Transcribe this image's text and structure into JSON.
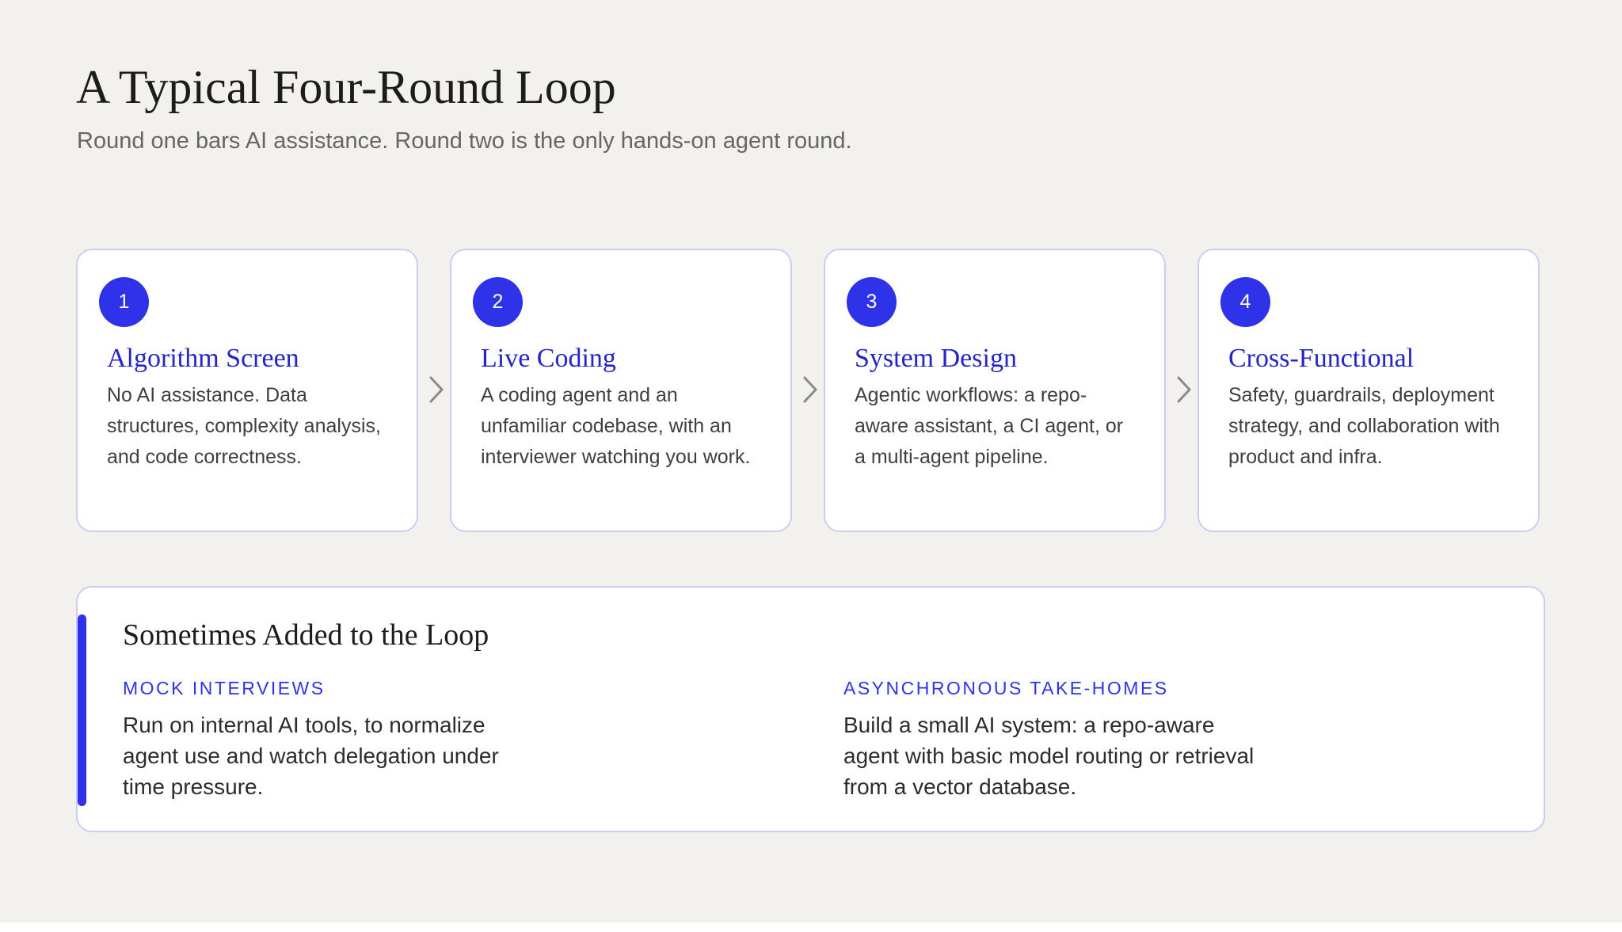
{
  "header": {
    "title": "A Typical Four-Round Loop",
    "subtitle": "Round one bars AI assistance. Round two is the only hands-on agent round."
  },
  "rounds": [
    {
      "number": "1",
      "title": "Algorithm Screen",
      "description": "No AI assistance. Data structures, complexity analysis, and code correctness."
    },
    {
      "number": "2",
      "title": "Live Coding",
      "description": "A coding agent and an unfamiliar codebase, with an interviewer watching you work."
    },
    {
      "number": "3",
      "title": "System Design",
      "description": "Agentic workflows: a repo-aware assistant, a CI agent, or a multi-agent pipeline."
    },
    {
      "number": "4",
      "title": "Cross-Functional",
      "description": "Safety, guardrails, deployment strategy, and collaboration with product and infra."
    }
  ],
  "extras": {
    "title": "Sometimes Added to the Loop",
    "items": [
      {
        "label": "Mock Interviews",
        "description": "Run on internal AI tools, to normalize agent use and watch delegation under time pressure."
      },
      {
        "label": "Asynchronous Take-Homes",
        "description": "Build a small AI system: a repo-aware agent with basic model routing or retrieval from a vector database."
      }
    ]
  },
  "colors": {
    "accent": "#2e33ea",
    "card_title": "#2424c8",
    "card_border": "#ccccf5",
    "background": "#f2f1ee",
    "connector": "#8a8a8a"
  },
  "icons": {
    "connector": "chevron-right-icon"
  }
}
